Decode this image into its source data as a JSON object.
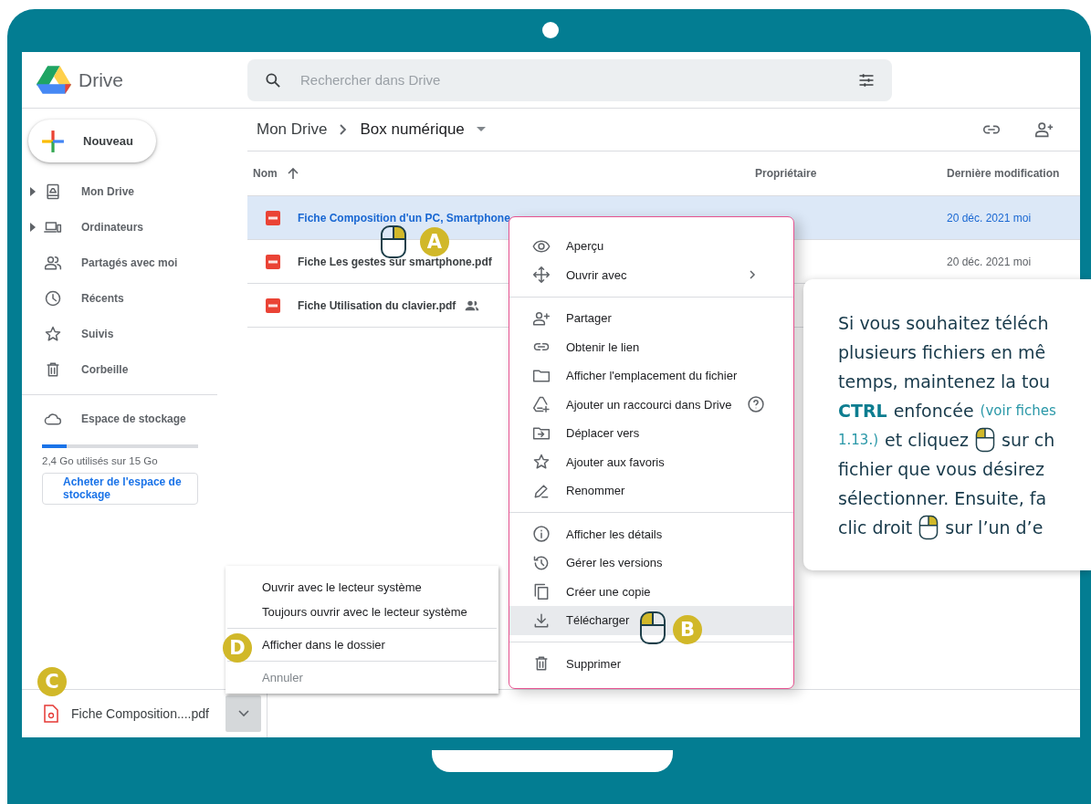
{
  "app": {
    "name": "Drive"
  },
  "search": {
    "placeholder": "Rechercher dans Drive"
  },
  "new_button": "Nouveau",
  "sidebar": {
    "items": [
      {
        "label": "Mon Drive",
        "expandable": true
      },
      {
        "label": "Ordinateurs",
        "expandable": true
      },
      {
        "label": "Partagés avec moi",
        "expandable": false
      },
      {
        "label": "Récents",
        "expandable": false
      },
      {
        "label": "Suivis",
        "expandable": false
      },
      {
        "label": "Corbeille",
        "expandable": false
      }
    ],
    "storage": {
      "label": "Espace de stockage",
      "level": 0.16,
      "usage": "2,4 Go utilisés sur 15 Go",
      "button": "Acheter de l'espace de stockage"
    }
  },
  "breadcrumb": [
    {
      "label": "Mon Drive"
    },
    {
      "label": "Box numérique"
    }
  ],
  "table": {
    "columns": [
      "Nom",
      "Propriétaire",
      "Dernière modification"
    ],
    "rows": [
      {
        "name": "Fiche Composition d'un PC, Smartphone",
        "selected": true,
        "shared": false,
        "modified": "20 déc. 2021 moi"
      },
      {
        "name": "Fiche Les gestes sur smartphone.pdf",
        "selected": false,
        "shared": false,
        "modified": "20 déc. 2021 moi"
      },
      {
        "name": "Fiche Utilisation du clavier.pdf",
        "selected": false,
        "shared": true
      }
    ]
  },
  "context_menu": {
    "groups": [
      {
        "items": [
          {
            "label": "Aperçu",
            "selected": false,
            "submenu": false,
            "help": false
          },
          {
            "label": "Ouvrir avec",
            "selected": false,
            "submenu": true,
            "help": false
          }
        ]
      },
      {
        "items": [
          {
            "label": "Partager",
            "selected": false,
            "submenu": false,
            "help": false
          },
          {
            "label": "Obtenir le lien",
            "selected": false,
            "submenu": false,
            "help": false
          },
          {
            "label": "Afficher l'emplacement du fichier",
            "selected": false,
            "submenu": false,
            "help": false
          },
          {
            "label": "Ajouter un raccourci dans Drive",
            "selected": false,
            "submenu": false,
            "help": true
          },
          {
            "label": "Déplacer vers",
            "selected": false,
            "submenu": false,
            "help": false
          },
          {
            "label": "Ajouter aux favoris",
            "selected": false,
            "submenu": false,
            "help": false
          },
          {
            "label": "Renommer",
            "selected": false,
            "submenu": false,
            "help": false
          }
        ]
      },
      {
        "items": [
          {
            "label": "Afficher les détails",
            "selected": false,
            "submenu": false,
            "help": false
          },
          {
            "label": "Gérer les versions",
            "selected": false,
            "submenu": false,
            "help": false
          },
          {
            "label": "Créer une copie",
            "selected": false,
            "submenu": false,
            "help": false
          },
          {
            "label": "Télécharger",
            "selected": true,
            "submenu": false,
            "help": false
          }
        ]
      },
      {
        "items": [
          {
            "label": "Supprimer",
            "selected": false,
            "submenu": false,
            "help": false
          }
        ]
      }
    ]
  },
  "download_menu": {
    "groups": [
      {
        "items": [
          {
            "label": "Ouvrir avec le lecteur système",
            "disabled": false
          },
          {
            "label": "Toujours ouvrir avec le lecteur système",
            "disabled": false
          }
        ]
      },
      {
        "items": [
          {
            "label": "Afficher dans le dossier",
            "disabled": false
          }
        ]
      },
      {
        "items": [
          {
            "label": "Annuler",
            "disabled": true
          }
        ]
      }
    ]
  },
  "download_bar": {
    "file": "Fiche Composition....pdf"
  },
  "markers": [
    {
      "label": "A"
    },
    {
      "label": "B"
    },
    {
      "label": "C"
    },
    {
      "label": "D"
    }
  ],
  "cursors": [
    {
      "right_click": true
    },
    {
      "right_click": false
    }
  ],
  "callout": {
    "lines": [
      [
        {
          "kind": "text",
          "text": "Si vous souhaitez téléch"
        }
      ],
      [
        {
          "kind": "text",
          "text": "plusieurs fichiers en mê"
        }
      ],
      [
        {
          "kind": "text",
          "text": "temps, maintenez la tou"
        }
      ],
      [
        {
          "kind": "key",
          "text": "CTRL"
        },
        {
          "kind": "text",
          "text": "enfoncée"
        },
        {
          "kind": "ref",
          "text": "(voir fiches"
        }
      ],
      [
        {
          "kind": "ref",
          "text": "1.13.)"
        },
        {
          "kind": "text",
          "text": "et cliquez"
        },
        {
          "kind": "mouse",
          "right_click": false
        },
        {
          "kind": "text",
          "text": "sur ch"
        }
      ],
      [
        {
          "kind": "text",
          "text": "fichier que vous désirez"
        }
      ],
      [
        {
          "kind": "text",
          "text": "sélectionner. Ensuite, fa"
        }
      ],
      [
        {
          "kind": "text",
          "text": "clic droit"
        },
        {
          "kind": "mouse",
          "right_click": true
        },
        {
          "kind": "text",
          "text": "sur l’un d’e"
        }
      ]
    ]
  }
}
